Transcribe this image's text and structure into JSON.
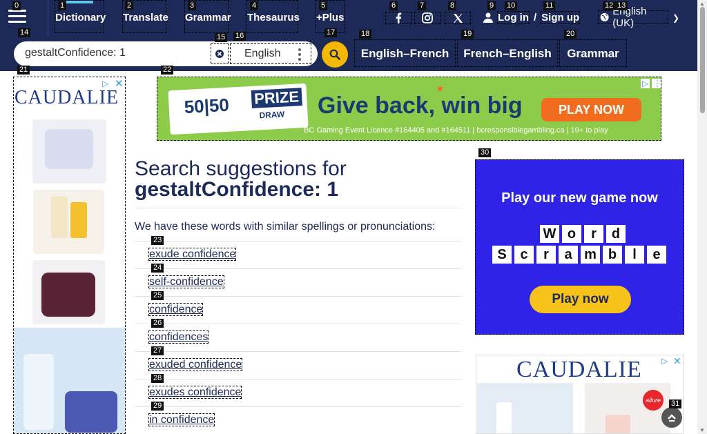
{
  "nav": {
    "items": [
      {
        "label": "Dictionary",
        "badge": "1"
      },
      {
        "label": "Translate",
        "badge": "2"
      },
      {
        "label": "Grammar",
        "badge": "3"
      },
      {
        "label": "Thesaurus",
        "badge": "4"
      },
      {
        "label": "+Plus",
        "badge": "5"
      }
    ],
    "menu_badge": "0",
    "social_badges": [
      "6",
      "7",
      "8"
    ],
    "login_badges": [
      "9",
      "10",
      "11"
    ],
    "login": "Log in",
    "slash": "/",
    "signup": "Sign up",
    "language": "English (UK)",
    "language_badges": [
      "12",
      "13"
    ]
  },
  "search": {
    "value": "gestaltConfidence: 1",
    "badge": "14",
    "clear_badge": "15",
    "dictionary": "English",
    "dictionary_badge": "16",
    "go_badge": "17"
  },
  "quicklinks": [
    {
      "label": "English–French",
      "badge": "18"
    },
    {
      "label": "French–English",
      "badge": "19"
    },
    {
      "label": "Grammar",
      "badge": "20"
    }
  ],
  "ads": {
    "left_badge": "21",
    "top_badge": "22",
    "right_badge": "30",
    "brand": "CAUDALIE",
    "top_headline": "Give back, win big",
    "top_cta": "PLAY NOW",
    "top_card_main": "50|50",
    "top_card_prize": "PRIZE",
    "top_card_draw": "DRAW",
    "top_fineprint": "BC Gaming Event Licence #164405 and #164511 | bcresponsiblegambling.ca | 19+ to play",
    "right_title": "Play our new game now",
    "right_word1": [
      "W",
      "o",
      "r",
      "d"
    ],
    "right_word2": [
      "S",
      "c",
      "r",
      "a",
      "m",
      "b",
      "l",
      "e"
    ],
    "right_cta": "Play now",
    "allure": "allure"
  },
  "main": {
    "heading_line1": "Search suggestions for",
    "heading_line2": "gestaltConfidence: 1",
    "intro": "We have these words with similar spellings or pronunciations:",
    "suggestions": [
      {
        "text": "exude confidence",
        "badge": "23"
      },
      {
        "text": "self-confidence",
        "badge": "24"
      },
      {
        "text": "confidence",
        "badge": "25"
      },
      {
        "text": "confidences",
        "badge": "26"
      },
      {
        "text": "exuded confidence",
        "badge": "27"
      },
      {
        "text": "exudes confidence",
        "badge": "28"
      },
      {
        "text": "in confidence",
        "badge": "29"
      }
    ]
  },
  "back_to_top_badge": "31",
  "colors": {
    "navy": "#1d2a57",
    "accent": "#f5b800",
    "link_bar": "#62c9f5"
  }
}
